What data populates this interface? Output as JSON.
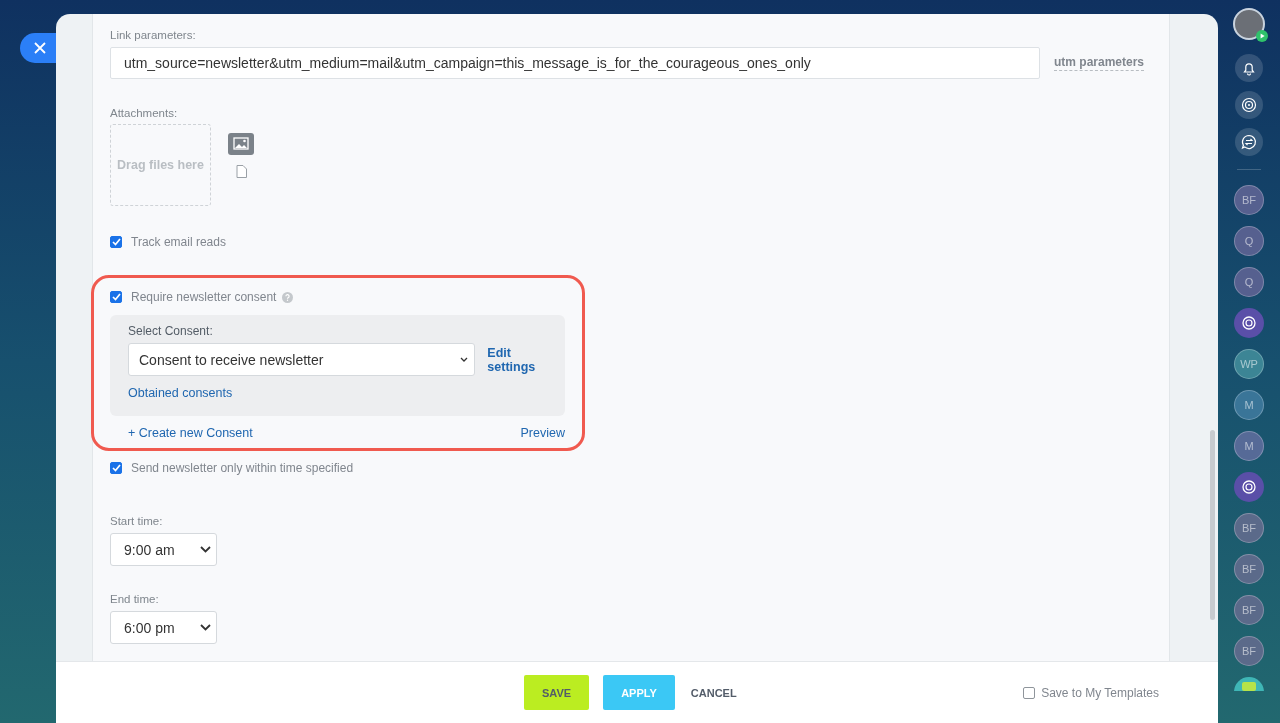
{
  "form": {
    "link_parameters": {
      "label": "Link parameters:",
      "value": "utm_source=newsletter&utm_medium=mail&utm_campaign=this_message_is_for_the_courageous_ones_only",
      "utm_link": "utm parameters"
    },
    "attachments": {
      "label": "Attachments:",
      "drop_hint": "Drag files here"
    },
    "track_reads": {
      "label": "Track email reads",
      "checked": true
    },
    "consent": {
      "label": "Require newsletter consent",
      "checked": true,
      "select_label": "Select Consent:",
      "select_value": "Consent to receive newsletter",
      "edit_link": "Edit settings",
      "obtained_link": "Obtained consents",
      "create_link": "+ Create new Consent",
      "preview_link": "Preview"
    },
    "time_limit": {
      "label": "Send newsletter only within time specified",
      "checked": true
    },
    "start_time": {
      "label": "Start time:",
      "value": "9:00 am"
    },
    "end_time": {
      "label": "End time:",
      "value": "6:00 pm"
    }
  },
  "footer": {
    "buttons": [
      {
        "label": "SAVE",
        "kind": "save"
      },
      {
        "label": "APPLY",
        "kind": "apply"
      },
      {
        "label": "CANCEL",
        "kind": "cancel"
      }
    ],
    "save_template": {
      "label": "Save to My Templates",
      "checked": false
    }
  },
  "sidebar": {
    "items": [
      {
        "kind": "avatar"
      },
      {
        "kind": "bell"
      },
      {
        "kind": "spiral"
      },
      {
        "kind": "chat"
      },
      {
        "kind": "divider"
      },
      {
        "kind": "contact",
        "initials": "BF",
        "color": "#56608f"
      },
      {
        "kind": "contact",
        "initials": "Q",
        "color": "#56608f"
      },
      {
        "kind": "contact",
        "initials": "Q",
        "color": "#56608f"
      },
      {
        "kind": "channel",
        "color": "#5a4fa8"
      },
      {
        "kind": "contact",
        "initials": "WP",
        "color": "#3c8595"
      },
      {
        "kind": "contact",
        "initials": "M",
        "color": "#3a7598"
      },
      {
        "kind": "contact",
        "initials": "M",
        "color": "#566a97"
      },
      {
        "kind": "channel",
        "color": "#5a4fa8"
      },
      {
        "kind": "contact",
        "initials": "BF",
        "color": "#5b6a8a"
      },
      {
        "kind": "contact",
        "initials": "BF",
        "color": "#5b6a8a"
      },
      {
        "kind": "contact",
        "initials": "BF",
        "color": "#5b6a8a"
      },
      {
        "kind": "contact",
        "initials": "BF",
        "color": "#5b6a8a"
      },
      {
        "kind": "messages"
      }
    ]
  }
}
